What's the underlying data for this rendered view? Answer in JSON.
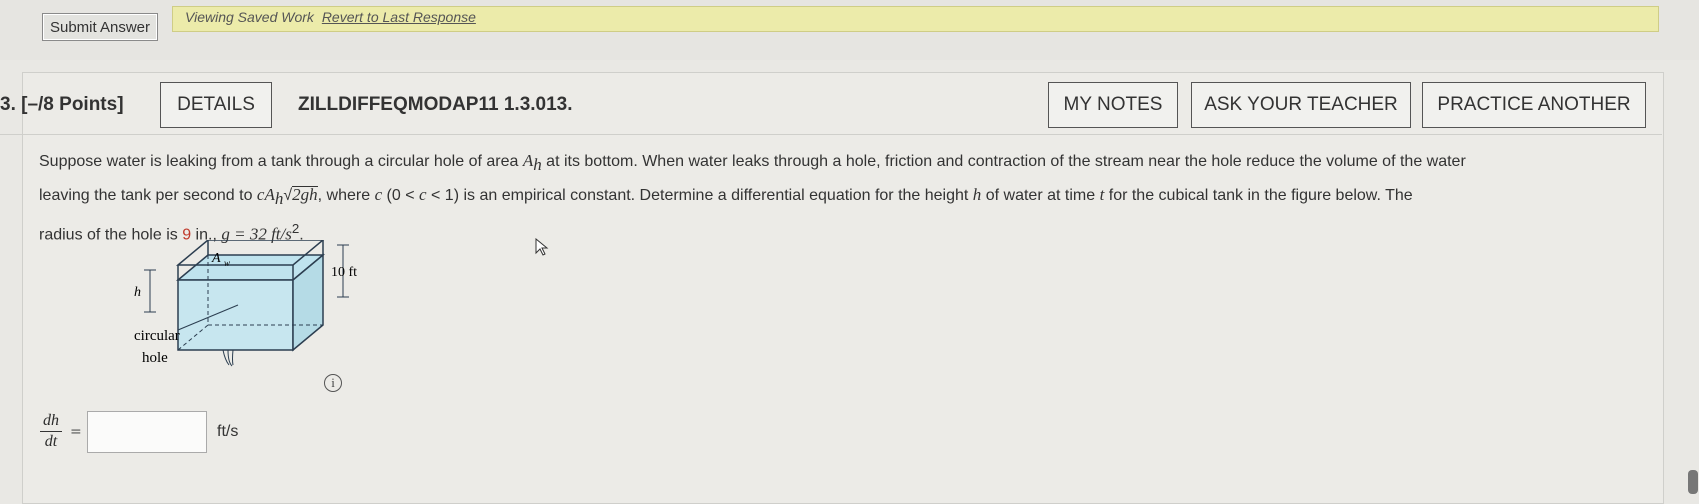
{
  "toolbar": {
    "submit_label": "Submit Answer"
  },
  "banner": {
    "status_text": "Viewing Saved Work",
    "revert_link": "Revert to Last Response"
  },
  "question": {
    "number": "3. [–/8 Points]",
    "details_label": "DETAILS",
    "code": "ZILLDIFFEQMODAP11 1.3.013.",
    "my_notes_label": "MY NOTES",
    "ask_teacher_label": "ASK YOUR TEACHER",
    "practice_label": "PRACTICE ANOTHER",
    "text_line1_a": "Suppose water is leaking from a tank through a circular hole of area ",
    "text_line1_b": " at its bottom. When water leaks through a hole, friction and contraction of the stream near the hole reduce the volume of the water",
    "text_line2_a": "leaving the tank per second to ",
    "text_line2_b": ", where ",
    "text_line2_c": " (0 < ",
    "text_line2_d": " < 1) is an empirical constant. Determine a differential equation for the height ",
    "text_line2_e": " of water at time ",
    "text_line2_f": " for the cubical tank in the figure below. The",
    "text_line3_a": "radius of the hole is ",
    "radius_value": "9",
    "text_line3_b": " in., ",
    "g_expr": "g = 32 ft/s",
    "sym_Ah": "A",
    "sym_h_sub": "h",
    "sym_c": "c",
    "sym_h": "h",
    "sym_t": "t",
    "sym_expr": "cA",
    "sym_sqrt": "2gh"
  },
  "figure": {
    "label_aw": "A",
    "label_aw_sub": "w",
    "label_10ft": "10 ft",
    "label_h": "h",
    "label_circular": "circular",
    "label_hole": "hole",
    "water_color": "#bfe3ee",
    "tank_edge_color": "#2c3e50"
  },
  "answer": {
    "lhs_num": "dh",
    "lhs_den": "dt",
    "equals": "=",
    "value": "",
    "units": "ft/s"
  }
}
